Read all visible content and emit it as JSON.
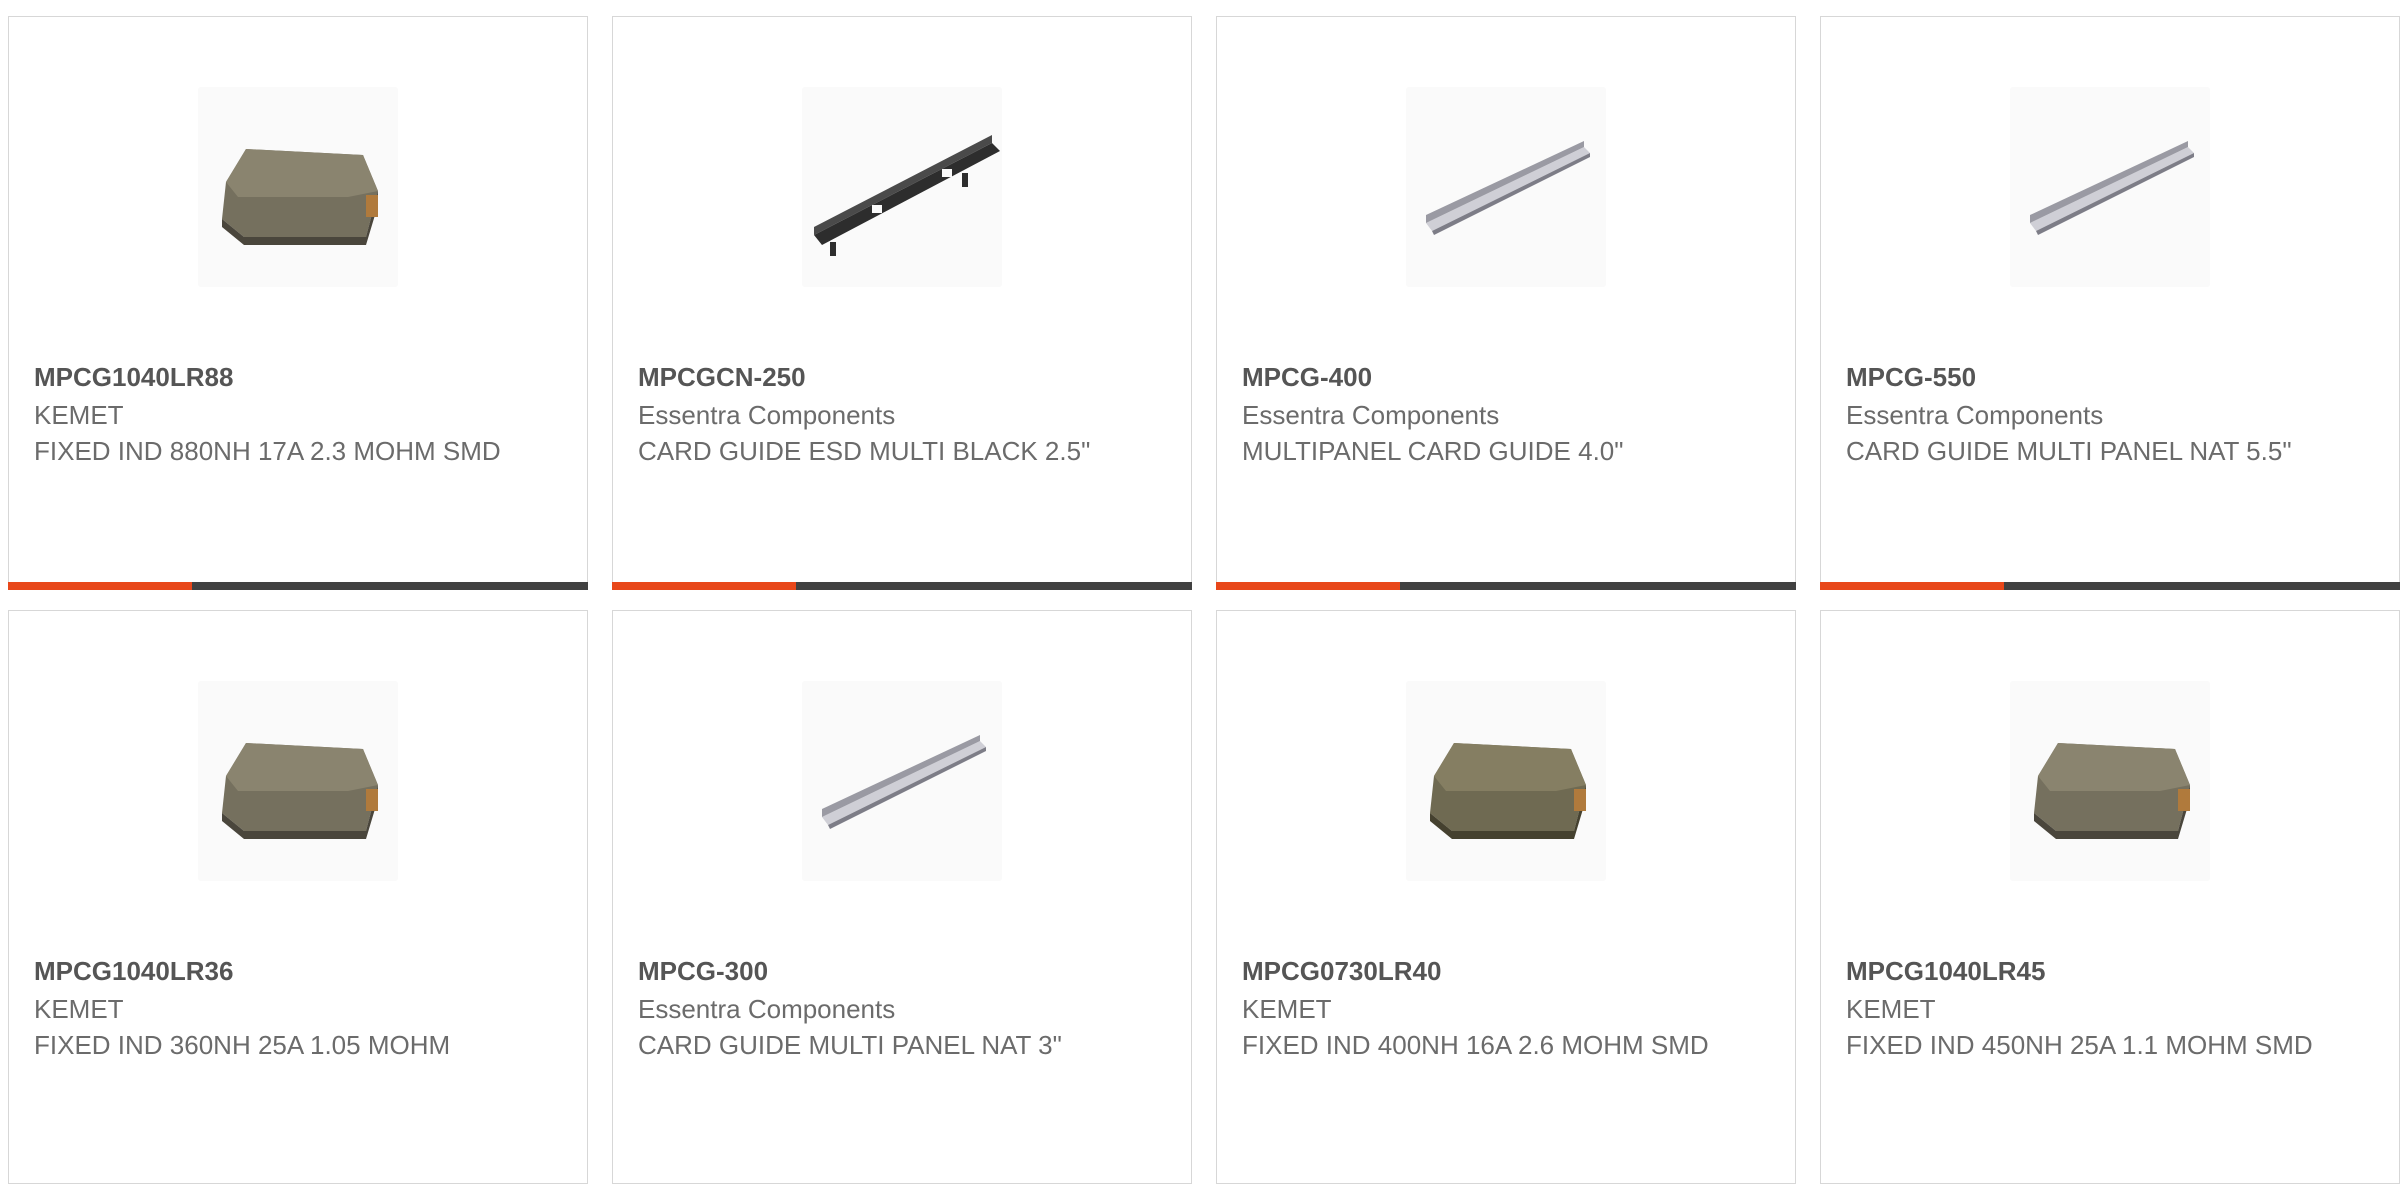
{
  "colors": {
    "accent": "#e8471a",
    "bar": "#414141",
    "text": "#6b6b6b",
    "border": "#d7d7d7"
  },
  "products": [
    {
      "part_number": "MPCG1040LR88",
      "manufacturer": "KEMET",
      "description": "FIXED IND 880NH 17A 2.3 MOHM SMD",
      "image": "inductor-image"
    },
    {
      "part_number": "MPCGCN-250",
      "manufacturer": "Essentra Components",
      "description": "CARD GUIDE ESD MULTI BLACK 2.5\"",
      "image": "black-card-guide-image"
    },
    {
      "part_number": "MPCG-400",
      "manufacturer": "Essentra Components",
      "description": "MULTIPANEL CARD GUIDE 4.0\"",
      "image": "card-guide-image"
    },
    {
      "part_number": "MPCG-550",
      "manufacturer": "Essentra Components",
      "description": "CARD GUIDE MULTI PANEL NAT 5.5\"",
      "image": "card-guide-image"
    },
    {
      "part_number": "MPCG1040LR36",
      "manufacturer": "KEMET",
      "description": "FIXED IND 360NH 25A 1.05 MOHM",
      "image": "inductor-image"
    },
    {
      "part_number": "MPCG-300",
      "manufacturer": "Essentra Components",
      "description": "CARD GUIDE MULTI PANEL NAT 3\"",
      "image": "card-guide-image"
    },
    {
      "part_number": "MPCG0730LR40",
      "manufacturer": "KEMET",
      "description": "FIXED IND 400NH 16A 2.6 MOHM SMD",
      "image": "inductor-image"
    },
    {
      "part_number": "MPCG1040LR45",
      "manufacturer": "KEMET",
      "description": "FIXED IND 450NH 25A 1.1 MOHM SMD",
      "image": "inductor-image"
    }
  ]
}
